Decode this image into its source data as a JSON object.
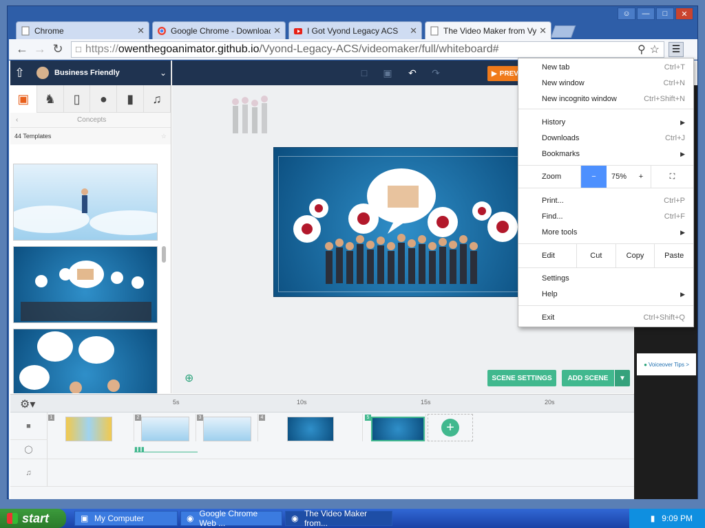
{
  "window": {
    "buttons": [
      "person-icon",
      "minimize-icon",
      "maximize-icon",
      "close-icon"
    ]
  },
  "tabs": [
    {
      "label": "Chrome",
      "icon": "page-icon"
    },
    {
      "label": "Google Chrome - Download",
      "icon": "chrome-icon"
    },
    {
      "label": "I Got Vyond Legacy ACS",
      "icon": "youtube-icon"
    },
    {
      "label": "The Video Maker from Vyond",
      "icon": "page-icon",
      "active": true
    }
  ],
  "address": {
    "scheme": "https://",
    "host": "owenthegoanimator.github.io",
    "path": "/Vyond-Legacy-ACS/videomaker/full/whiteboard#"
  },
  "app": {
    "theme_name": "Business Friendly",
    "concepts_label": "Concepts",
    "template_count": "44 Templates",
    "preview_label": "PREVIEW",
    "scene_settings": "SCENE SETTINGS",
    "add_scene": "ADD SCENE",
    "voiceover_tips": "Voiceover Tips >"
  },
  "timeline": {
    "ticks": [
      "5s",
      "10s",
      "15s",
      "20s"
    ],
    "clips": [
      "1",
      "2",
      "3",
      "4",
      "5"
    ]
  },
  "menu": {
    "items": [
      {
        "label": "New tab",
        "key": "Ctrl+T"
      },
      {
        "label": "New window",
        "key": "Ctrl+N"
      },
      {
        "label": "New incognito window",
        "key": "Ctrl+Shift+N"
      },
      {
        "label": "History",
        "key": ""
      },
      {
        "label": "Downloads",
        "key": "Ctrl+J"
      },
      {
        "label": "Bookmarks",
        "key": ""
      },
      {
        "label": "Print...",
        "key": "Ctrl+P"
      },
      {
        "label": "Find...",
        "key": "Ctrl+F"
      },
      {
        "label": "More tools",
        "key": ""
      },
      {
        "label": "Settings",
        "key": ""
      },
      {
        "label": "Help",
        "key": ""
      },
      {
        "label": "Exit",
        "key": "Ctrl+Shift+Q"
      }
    ],
    "zoom_label": "Zoom",
    "zoom_minus": "−",
    "zoom_value": "75%",
    "zoom_plus": "+",
    "edit_label": "Edit",
    "cut": "Cut",
    "copy": "Copy",
    "paste": "Paste"
  },
  "taskbar": {
    "start": "start",
    "tasks": [
      "My Computer",
      "Google Chrome Web ...",
      "The Video Maker from..."
    ],
    "time": "9:09 PM"
  },
  "colors": {
    "accent_green": "#41b88e",
    "preview_orange": "#f07a1a",
    "menu_zoom_blue": "#4d90fe"
  }
}
